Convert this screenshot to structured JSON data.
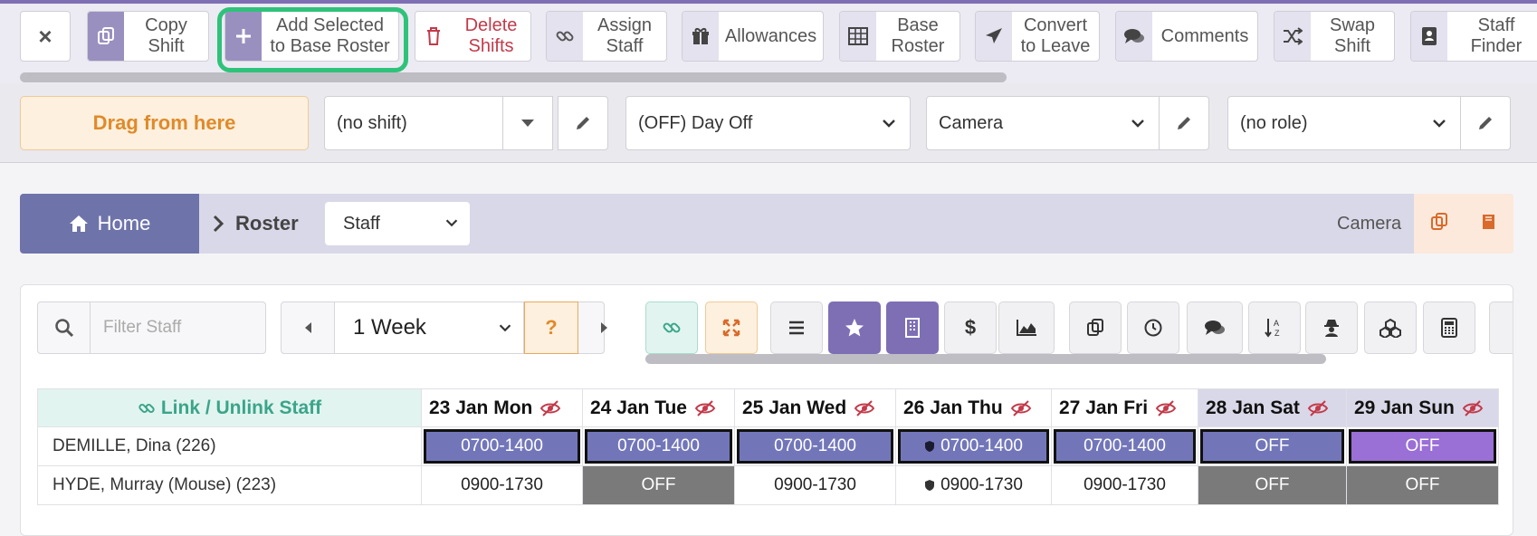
{
  "toolbar": {
    "close_label": "×",
    "buttons": [
      {
        "label": "Copy\nShift",
        "icon": "copy-icon"
      },
      {
        "label": "Add Selected\nto Base Roster",
        "icon": "plus-icon"
      },
      {
        "label": "Delete\nShifts",
        "icon": "trash-icon"
      },
      {
        "label": "Assign\nStaff",
        "icon": "link-icon"
      },
      {
        "label": "Allowances",
        "icon": "gift-icon"
      },
      {
        "label": "Base\nRoster",
        "icon": "table-icon"
      },
      {
        "label": "Convert\nto Leave",
        "icon": "plane-icon"
      },
      {
        "label": "Comments",
        "icon": "comments-icon"
      },
      {
        "label": "Swap\nShift",
        "icon": "shuffle-icon"
      },
      {
        "label": "Staff\nFinder",
        "icon": "address-book-icon"
      }
    ]
  },
  "filters": {
    "drag_label": "Drag from here",
    "shift_value": "(no shift)",
    "shift_type_value": "(OFF) Day Off",
    "location_value": "Camera",
    "role_value": "(no role)"
  },
  "breadcrumb": {
    "home_label": "Home",
    "roster_label": "Roster",
    "view_select": "Staff",
    "location_label": "Camera"
  },
  "controls": {
    "filter_placeholder": "Filter Staff",
    "period_value": "1 Week",
    "help_label": "?"
  },
  "grid": {
    "link_header": "Link / Unlink Staff",
    "days": [
      {
        "label": "23 Jan Mon",
        "weekend": false
      },
      {
        "label": "24 Jan Tue",
        "weekend": false
      },
      {
        "label": "25 Jan Wed",
        "weekend": false
      },
      {
        "label": "26 Jan Thu",
        "weekend": false
      },
      {
        "label": "27 Jan Fri",
        "weekend": false
      },
      {
        "label": "28 Jan Sat",
        "weekend": true
      },
      {
        "label": "29 Jan Sun",
        "weekend": true
      }
    ],
    "rows": [
      {
        "name": "DEMILLE, Dina (226)",
        "cells": [
          "0700-1400",
          "0700-1400",
          "0700-1400",
          "0700-1400",
          "0700-1400",
          "OFF",
          "OFF"
        ]
      },
      {
        "name": "HYDE, Murray (Mouse) (223)",
        "cells": [
          "0900-1730",
          "OFF",
          "0900-1730",
          "0900-1730",
          "0900-1730",
          "OFF",
          "OFF"
        ]
      }
    ]
  },
  "colors": {
    "accent": "#7e6fb5",
    "shift_purple": "#7276b9",
    "shift_violet": "#9a6fd6",
    "off_grey": "#7a7a7a",
    "teal": "#3aa58a",
    "orange": "#e08a2a",
    "highlight_ring": "#2fc27a"
  }
}
